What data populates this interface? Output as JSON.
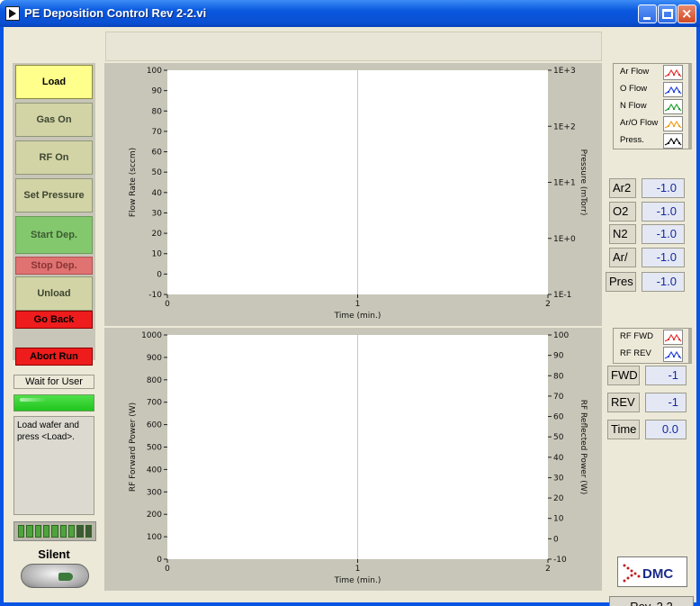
{
  "window": {
    "title": "PE Deposition Control Rev 2-2.vi"
  },
  "colors": {
    "titlebar": "#0a54e3",
    "load": "#ffff8c",
    "start": "#84c86e",
    "abort": "#ee1c1c",
    "value_text": "#1428a0"
  },
  "buttons": {
    "load": "Load",
    "gas_on": "Gas On",
    "rf_on": "RF On",
    "set_pressure": "Set Pressure",
    "start_dep": "Start Dep.",
    "stop_dep": "Stop Dep.",
    "unload": "Unload",
    "go_back": "Go Back",
    "abort_run": "Abort Run"
  },
  "status": {
    "label": "Wait for User",
    "message": "Load wafer and press <Load>."
  },
  "silent": {
    "label": "Silent"
  },
  "flow_legend": [
    {
      "label": "Ar Flow",
      "color": "#e83030"
    },
    {
      "label": "O Flow",
      "color": "#2040e0"
    },
    {
      "label": "N Flow",
      "color": "#20a030"
    },
    {
      "label": "Ar/O Flow",
      "color": "#f0a020"
    },
    {
      "label": "Press.",
      "color": "#111111"
    }
  ],
  "flow_readouts": [
    {
      "name": "Ar2",
      "value": "-1.0"
    },
    {
      "name": "O2",
      "value": "-1.0"
    },
    {
      "name": "N2",
      "value": "-1.0"
    },
    {
      "name": "Ar/",
      "value": "-1.0"
    }
  ],
  "pres_readout": {
    "name": "Pres",
    "value": "-1.0"
  },
  "rf_legend": [
    {
      "label": "RF FWD",
      "color": "#e83030"
    },
    {
      "label": "RF REV",
      "color": "#2040e0"
    }
  ],
  "rf_readouts": [
    {
      "name": "FWD",
      "value": "-1"
    },
    {
      "name": "REV",
      "value": "-1"
    },
    {
      "name": "Time",
      "value": "0.0"
    }
  ],
  "logo": {
    "text": "DMC"
  },
  "revision": "Rev. 2.2",
  "chart_data": [
    {
      "type": "line",
      "ylabel": "Flow Rate (sccm)",
      "y2label": "Pressure (mTorr)",
      "xlabel": "Time (min.)",
      "x_ticks": [
        "0",
        "1",
        "2"
      ],
      "xlim": [
        0,
        2
      ],
      "y_ticks": [
        "100",
        "90",
        "80",
        "70",
        "60",
        "50",
        "40",
        "30",
        "20",
        "10",
        "0",
        "-10"
      ],
      "ylim": [
        -10,
        100
      ],
      "y2_ticks": [
        "1E+3",
        "1E+2",
        "1E+1",
        "1E+0",
        "1E-1"
      ],
      "y2_scale": "log",
      "series": []
    },
    {
      "type": "line",
      "ylabel": "RF Forward Power (W)",
      "y2label": "RF Reflected Power (W)",
      "xlabel": "Time (min.)",
      "x_ticks": [
        "0",
        "1",
        "2"
      ],
      "xlim": [
        0,
        2
      ],
      "y_ticks": [
        "1000",
        "900",
        "800",
        "700",
        "600",
        "500",
        "400",
        "300",
        "200",
        "100",
        "0"
      ],
      "ylim": [
        0,
        1000
      ],
      "y2_ticks": [
        "100",
        "90",
        "80",
        "70",
        "60",
        "50",
        "40",
        "30",
        "20",
        "10",
        "0",
        "-10"
      ],
      "y2lim": [
        -10,
        100
      ],
      "series": []
    }
  ]
}
